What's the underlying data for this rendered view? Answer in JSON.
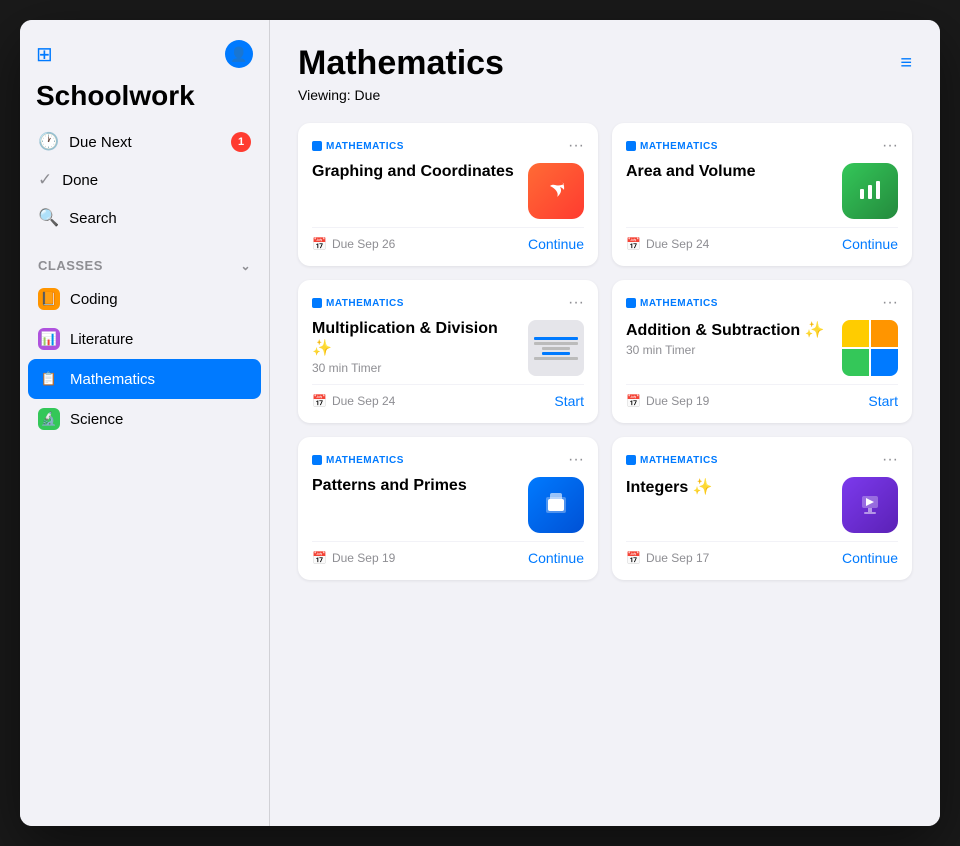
{
  "sidebar": {
    "title": "Schoolwork",
    "nav": [
      {
        "id": "due-next",
        "label": "Due Next",
        "icon": "🕐",
        "badge": "1"
      },
      {
        "id": "done",
        "label": "Done",
        "icon": "✓",
        "badge": null
      },
      {
        "id": "search",
        "label": "Search",
        "icon": "🔍",
        "badge": null
      }
    ],
    "classes_header": "Classes",
    "classes": [
      {
        "id": "coding",
        "label": "Coding",
        "color": "coding",
        "icon": "📙"
      },
      {
        "id": "literature",
        "label": "Literature",
        "color": "literature",
        "icon": "📊"
      },
      {
        "id": "mathematics",
        "label": "Mathematics",
        "color": "mathematics",
        "icon": "📋",
        "active": true
      },
      {
        "id": "science",
        "label": "Science",
        "color": "science",
        "icon": "🔬"
      }
    ]
  },
  "main": {
    "title": "Mathematics",
    "viewing_label": "Viewing: Due",
    "filter_icon": "⊜",
    "cards": [
      {
        "id": "graphing",
        "subject": "MATHEMATICS",
        "title": "Graphing and Coordinates",
        "subtitle": "",
        "due": "Due Sep 26",
        "action": "Continue",
        "app_icon": "swift",
        "more": "···"
      },
      {
        "id": "area-volume",
        "subject": "MATHEMATICS",
        "title": "Area and Volume",
        "subtitle": "",
        "due": "Due Sep 24",
        "action": "Continue",
        "app_icon": "numbers",
        "more": "···"
      },
      {
        "id": "multiplication",
        "subject": "MATHEMATICS",
        "title": "Multiplication & Division ✨",
        "subtitle": "30 min Timer",
        "due": "Due Sep 24",
        "action": "Start",
        "app_icon": "thumb-multi",
        "more": "···"
      },
      {
        "id": "addition",
        "subject": "MATHEMATICS",
        "title": "Addition & Subtraction ✨",
        "subtitle": "30 min Timer",
        "due": "Due Sep 19",
        "action": "Start",
        "app_icon": "thumb-add",
        "more": "···"
      },
      {
        "id": "patterns",
        "subject": "MATHEMATICS",
        "title": "Patterns and Primes",
        "subtitle": "",
        "due": "Due Sep 19",
        "action": "Continue",
        "app_icon": "files",
        "more": "···"
      },
      {
        "id": "integers",
        "subject": "MATHEMATICS",
        "title": "Integers ✨",
        "subtitle": "",
        "due": "Due Sep 17",
        "action": "Continue",
        "app_icon": "keynote",
        "more": "···"
      }
    ]
  }
}
